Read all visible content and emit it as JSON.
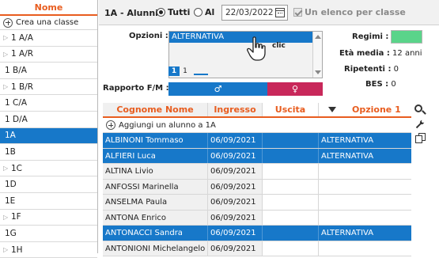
{
  "left_panel": {
    "header": "Nome",
    "create_label": "Crea una classe",
    "classes": [
      {
        "label": "1 A/A",
        "expandable": true,
        "selected": false
      },
      {
        "label": "1 A/R",
        "expandable": true,
        "selected": false
      },
      {
        "label": "1 B/A",
        "expandable": false,
        "selected": false
      },
      {
        "label": "1 B/R",
        "expandable": true,
        "selected": false
      },
      {
        "label": "1 C/A",
        "expandable": false,
        "selected": false
      },
      {
        "label": "1 D/A",
        "expandable": false,
        "selected": false
      },
      {
        "label": "1A",
        "expandable": false,
        "selected": true
      },
      {
        "label": "1B",
        "expandable": false,
        "selected": false
      },
      {
        "label": "1C",
        "expandable": true,
        "selected": false
      },
      {
        "label": "1D",
        "expandable": false,
        "selected": false
      },
      {
        "label": "1E",
        "expandable": false,
        "selected": false
      },
      {
        "label": "1F",
        "expandable": true,
        "selected": false
      },
      {
        "label": "1G",
        "expandable": false,
        "selected": false
      },
      {
        "label": "1H",
        "expandable": true,
        "selected": false
      }
    ]
  },
  "toolbar": {
    "title": "1A - Alunni",
    "radio_tutti": "Tutti",
    "radio_al": "Al",
    "date": "22/03/2022",
    "checkbox_label": "Un elenco per classe"
  },
  "options": {
    "label": "Opzioni :",
    "items": [
      "ALTERNATIVA"
    ],
    "page_current": "1",
    "page_other": "1",
    "cursor_text": "clic"
  },
  "rapporto": {
    "label": "Rapporto F/M :",
    "male_symbol": "♂",
    "female_symbol": "♀"
  },
  "info": {
    "regimi_label": "Regimi :",
    "eta_label": "Età media :",
    "eta_value": "12 anni",
    "ripetenti_label": "Ripetenti :",
    "ripetenti_value": "0",
    "bes_label": "BES :",
    "bes_value": "0"
  },
  "colors": {
    "accent_orange": "#e85d1f",
    "selection_blue": "#1778c9",
    "female_pink": "#c8285a",
    "regimi_green": "#5ad48a"
  },
  "table": {
    "headers": [
      "Cognome Nome",
      "Ingresso",
      "Uscita",
      "Opzione 1"
    ],
    "add_label": "Aggiungi un alunno a 1A",
    "rows": [
      {
        "name": "ALBINONI Tommaso",
        "ingresso": "06/09/2021",
        "uscita": "",
        "opzione": "ALTERNATIVA",
        "selected": true
      },
      {
        "name": "ALFIERI Luca",
        "ingresso": "06/09/2021",
        "uscita": "",
        "opzione": "ALTERNATIVA",
        "selected": true
      },
      {
        "name": "ALTINA Livio",
        "ingresso": "06/09/2021",
        "uscita": "",
        "opzione": "",
        "selected": false
      },
      {
        "name": "ANFOSSI Marinella",
        "ingresso": "06/09/2021",
        "uscita": "",
        "opzione": "",
        "selected": false
      },
      {
        "name": "ANSELMA Paula",
        "ingresso": "06/09/2021",
        "uscita": "",
        "opzione": "",
        "selected": false
      },
      {
        "name": "ANTONA Enrico",
        "ingresso": "06/09/2021",
        "uscita": "",
        "opzione": "",
        "selected": false
      },
      {
        "name": "ANTONACCI Sandra",
        "ingresso": "06/09/2021",
        "uscita": "",
        "opzione": "ALTERNATIVA",
        "selected": true
      },
      {
        "name": "ANTONIONI Michelangelo",
        "ingresso": "06/09/2021",
        "uscita": "",
        "opzione": "",
        "selected": false
      }
    ]
  }
}
